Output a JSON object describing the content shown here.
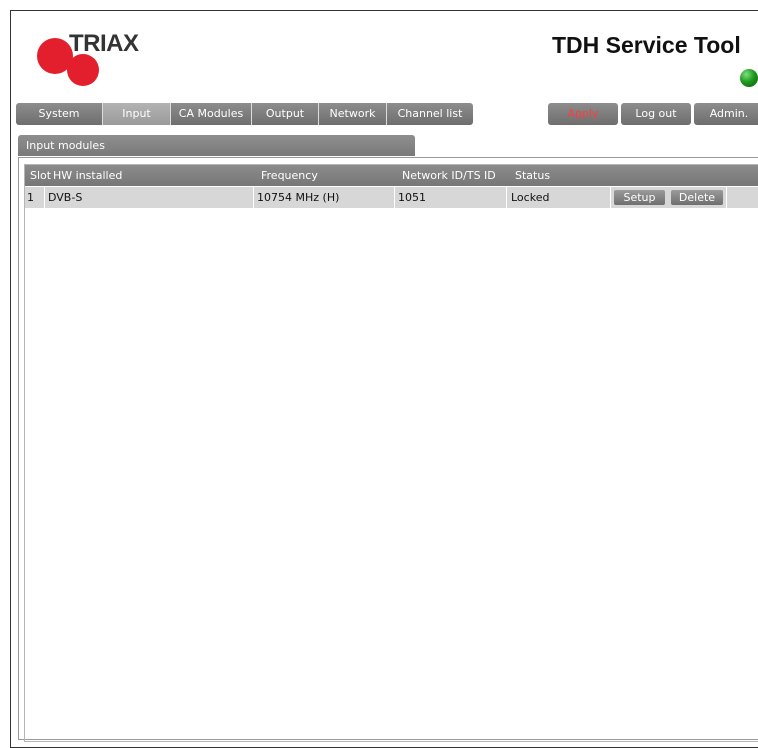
{
  "brand": {
    "logo_text": "TRIAX",
    "brand_red": "#e31e2d"
  },
  "app": {
    "title": "TDH Service Tool",
    "status_led_color": "#1e9a1e"
  },
  "nav": {
    "tabs": [
      {
        "label": "System",
        "active": false
      },
      {
        "label": "Input",
        "active": true
      },
      {
        "label": "CA Modules",
        "active": false
      },
      {
        "label": "Output",
        "active": false
      },
      {
        "label": "Network",
        "active": false
      },
      {
        "label": "Channel list",
        "active": false
      }
    ],
    "actions": {
      "apply": "Apply",
      "logout": "Log out",
      "admin": "Admin."
    }
  },
  "section": {
    "title": "Input modules"
  },
  "table": {
    "columns": {
      "slot": "Slot",
      "hw": "HW installed",
      "frequency": "Frequency",
      "netid": "Network ID/TS ID",
      "status": "Status"
    },
    "rows": [
      {
        "slot": "1",
        "hw": "DVB-S",
        "frequency": "10754 MHz (H)",
        "netid": "1051",
        "status": "Locked",
        "setup_label": "Setup",
        "delete_label": "Delete"
      }
    ]
  }
}
